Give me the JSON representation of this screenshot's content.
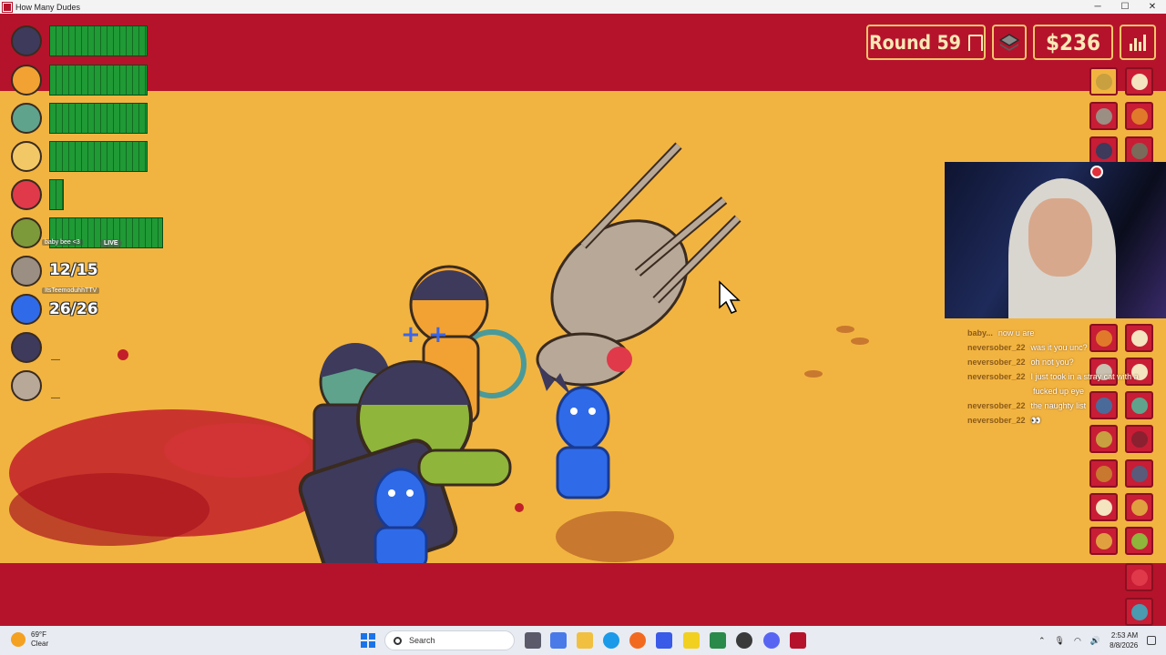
{
  "window": {
    "title": "How Many Dudes"
  },
  "hud": {
    "round_label": "Round 59",
    "money": "$236"
  },
  "roster": [
    {
      "name": "hooded-dude",
      "color": "#3d3a5c",
      "hp_fraction": 1.0
    },
    {
      "name": "frankenstein-dude",
      "color": "#f2a233",
      "hp_fraction": 1.0
    },
    {
      "name": "vampire-dude",
      "color": "#5fa38d",
      "hp_fraction": 1.0
    },
    {
      "name": "bandaged-dude",
      "color": "#f2c866",
      "hp_fraction": 1.0
    },
    {
      "name": "devil-dude",
      "color": "#e0394a",
      "hp_fraction": 0.15
    },
    {
      "name": "zombie-dude",
      "color": "#7d9a3a",
      "hp_fraction": 1.0
    }
  ],
  "counts": [
    {
      "label": "12/15"
    },
    {
      "label": "26/26"
    }
  ],
  "roster_dashes": [
    "—",
    "—"
  ],
  "stream_overlay": {
    "viewer_1": "baby bee <3",
    "live": "LIVE",
    "viewer_2": "ItsTeemoduhhTTV"
  },
  "chat": [
    {
      "user": "baby...",
      "message": "now u are"
    },
    {
      "user": "neversober_22",
      "message": "was it you unc?"
    },
    {
      "user": "neversober_22",
      "message": "oh not you?"
    },
    {
      "user": "neversober_22",
      "message": "I just took in a stray cat with a"
    },
    {
      "user": "",
      "message": "fucked up eye"
    },
    {
      "user": "neversober_22",
      "message": "the naughty list"
    },
    {
      "user": "neversober_22",
      "message": "👀"
    }
  ],
  "taskbar": {
    "temperature": "69°F",
    "weather": "Clear",
    "search_placeholder": "Search",
    "time": "2:53 AM",
    "date": "8/8/2026"
  },
  "colors": {
    "background_red": "#b5132b",
    "arena_orange": "#f2b440",
    "hp_green": "#1f9a35",
    "hud_text": "#fbe8b6"
  },
  "icons": {
    "round": "gate-icon",
    "layers": "layers-icon",
    "stats": "bar-chart-icon"
  }
}
